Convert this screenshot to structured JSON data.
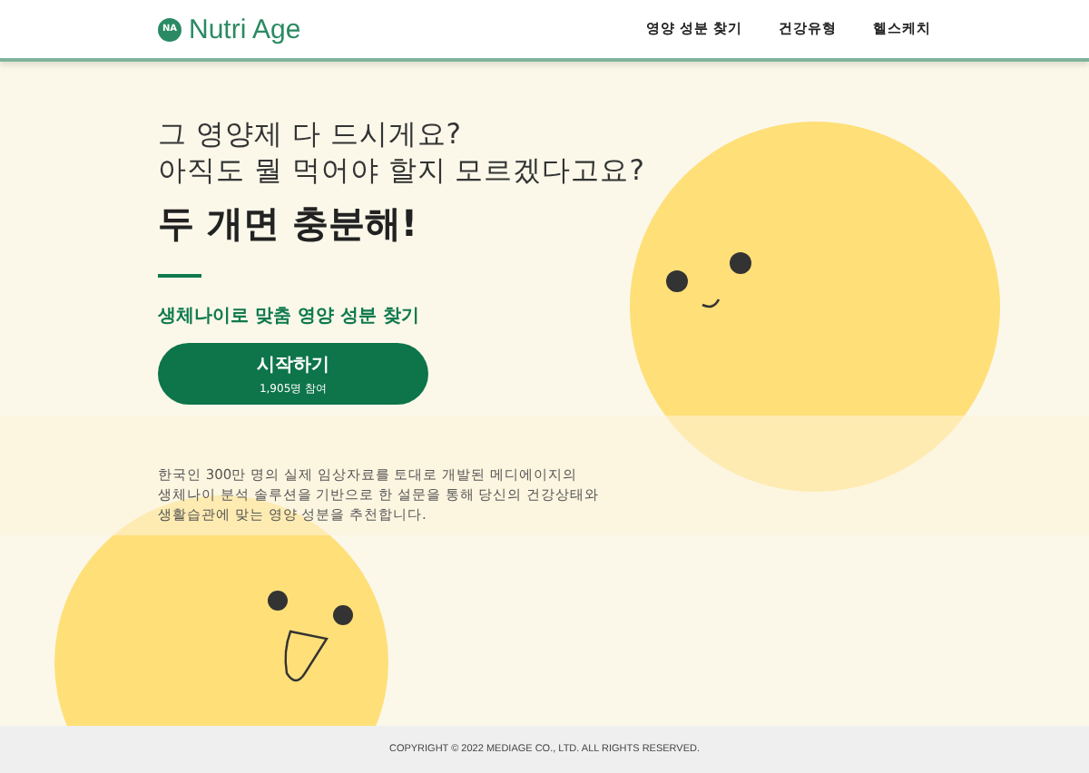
{
  "header": {
    "logo_mark": "NA",
    "logo_text": "Nutri Age",
    "nav": [
      {
        "label": "영양 성분 찾기"
      },
      {
        "label": "건강유형"
      },
      {
        "label": "헬스케치"
      }
    ]
  },
  "hero": {
    "lines": [
      "그 영양제 다 드시게요?",
      "아직도 뭘 먹어야 할지 모르겠다고요?"
    ],
    "headline": "두 개면 충분해!",
    "subtitle": "생체나이로 맞춤 영양 성분 찾기",
    "button": {
      "label": "시작하기",
      "count": "1,905명 참여"
    },
    "description": "한국인 300만 명의 실제 임상자료를 토대로 개발된 메디에이지의\n생체나이 분석 솔루션을 기반으로 한 설문을 통해 당신의 건강상태와\n생활습관에 맞는 영양 성분을 추천합니다."
  },
  "footer": {
    "copyright": "COPYRIGHT © 2022 MEDIAGE CO., LTD. ALL RIGHTS RESERVED."
  }
}
